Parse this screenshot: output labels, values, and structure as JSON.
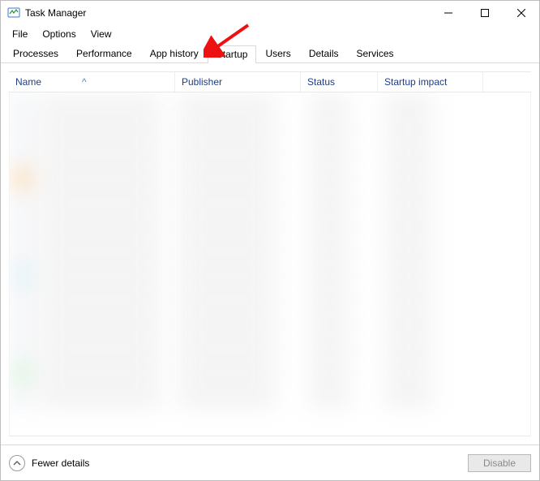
{
  "window": {
    "title": "Task Manager"
  },
  "menu": {
    "file": "File",
    "options": "Options",
    "view": "View"
  },
  "tabs": {
    "processes": "Processes",
    "performance": "Performance",
    "app_history": "App history",
    "startup": "Startup",
    "users": "Users",
    "details": "Details",
    "services": "Services",
    "active": "startup"
  },
  "columns": {
    "name": "Name",
    "publisher": "Publisher",
    "status": "Status",
    "impact": "Startup impact",
    "sort_indicator": "^"
  },
  "footer": {
    "fewer": "Fewer details",
    "disable": "Disable"
  },
  "annotation": {
    "arrow_target": "tab-startup"
  }
}
